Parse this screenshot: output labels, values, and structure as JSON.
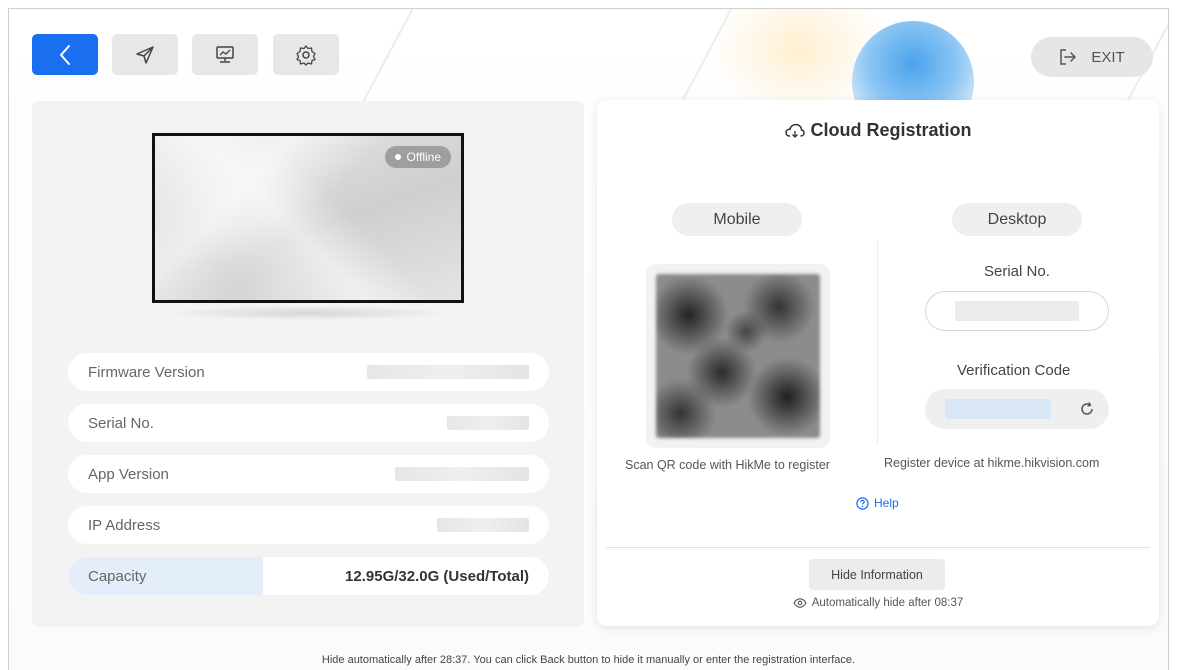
{
  "toolbar": {
    "icons": [
      "chevron-left-icon",
      "send-icon",
      "monitor-icon",
      "gear-icon"
    ],
    "exit_label": "EXIT",
    "exit_icon": "logout-icon",
    "primary_color": "#1a6ff0"
  },
  "device": {
    "status": "Offline",
    "info_rows": [
      {
        "label": "Firmware Version"
      },
      {
        "label": "Serial No."
      },
      {
        "label": "App Version"
      },
      {
        "label": "IP Address"
      }
    ],
    "capacity": {
      "label": "Capacity",
      "value": "12.95G/32.0G (Used/Total)",
      "used_fraction": 0.4047
    }
  },
  "registration": {
    "title": "Cloud Registration",
    "title_icon": "cloud-icon",
    "switch_icon": "swap-icon",
    "mobile": {
      "label": "Mobile",
      "caption": "Scan QR code with HikMe to register"
    },
    "desktop": {
      "label": "Desktop",
      "serial_label": "Serial No.",
      "code_label": "Verification Code",
      "caption": "Register device at hikme.hikvision.com"
    },
    "help_label": "Help",
    "hide_button": "Hide Information",
    "auto_hide": "Automatically hide after 08:37"
  },
  "footer_note": "Hide automatically after 28:37. You can click Back button to hide it manually or enter the registration interface."
}
